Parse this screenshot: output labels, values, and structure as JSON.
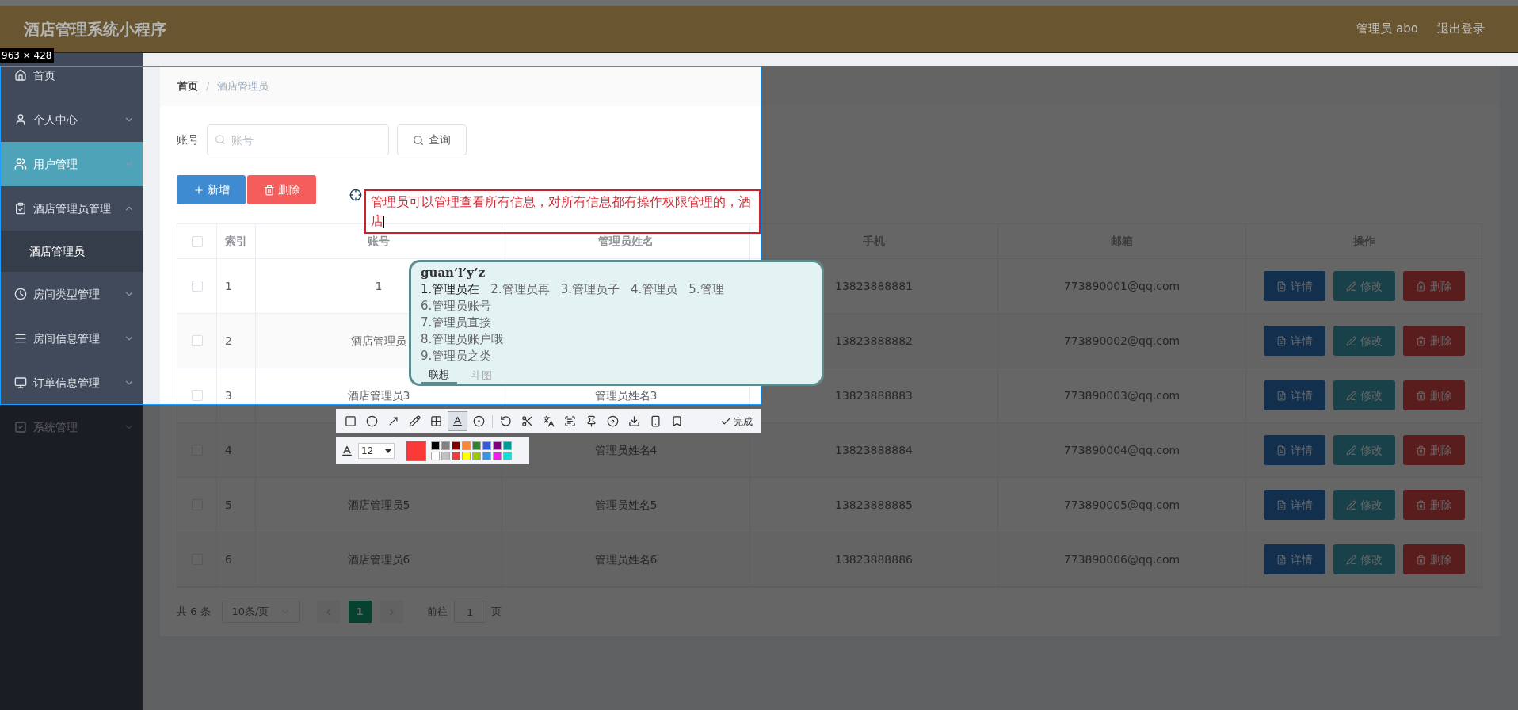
{
  "header": {
    "title": "酒店管理系统小程序",
    "user": "管理员 abo",
    "logout": "退出登录"
  },
  "sidebar": {
    "items": [
      {
        "label": "首页",
        "selected": false
      },
      {
        "label": "个人中心",
        "selected": false,
        "expanded": false
      },
      {
        "label": "用户管理",
        "selected": true,
        "expanded": false
      },
      {
        "label": "酒店管理员管理",
        "selected": false,
        "expanded": true,
        "children": [
          {
            "label": "酒店管理员",
            "selected": false
          }
        ]
      },
      {
        "label": "房间类型管理",
        "selected": false,
        "expanded": false
      },
      {
        "label": "房间信息管理",
        "selected": false,
        "expanded": false
      },
      {
        "label": "订单信息管理",
        "selected": false,
        "expanded": false
      },
      {
        "label": "系统管理",
        "selected": false,
        "expanded": false
      }
    ]
  },
  "breadcrumb": {
    "items": [
      "首页",
      "酒店管理员"
    ],
    "separator": "/"
  },
  "search": {
    "label": "账号",
    "placeholder": "账号",
    "button": "查询"
  },
  "toolbar": {
    "add": "新增",
    "delete": "删除"
  },
  "table": {
    "select_all": {
      "checked": false
    },
    "columns": [
      "索引",
      "账号",
      "管理员姓名",
      "手机",
      "邮箱",
      "操作"
    ],
    "rows": [
      {
        "checked": false,
        "index": "1",
        "account": "1",
        "phone": "13823888881",
        "email": "773890001@qq.com",
        "actions": [
          "详情",
          "修改",
          "删除"
        ]
      },
      {
        "checked": false,
        "index": "2",
        "account": "酒店管理员",
        "phone": "13823888882",
        "email": "773890002@qq.com",
        "actions": [
          "详情",
          "修改",
          "删除"
        ]
      },
      {
        "checked": false,
        "index": "3",
        "account": "酒店管理员3",
        "name": "管理员姓名3",
        "phone": "13823888883",
        "email": "773890003@qq.com",
        "actions": [
          "详情",
          "修改",
          "删除"
        ]
      },
      {
        "checked": false,
        "index": "4",
        "name": "管理员姓名4",
        "phone": "13823888884",
        "email": "773890004@qq.com",
        "actions": [
          "详情",
          "修改",
          "删除"
        ]
      },
      {
        "checked": false,
        "index": "5",
        "account": "酒店管理员5",
        "name": "管理员姓名5",
        "phone": "13823888885",
        "email": "773890005@qq.com",
        "actions": [
          "详情",
          "修改",
          "删除"
        ]
      },
      {
        "checked": false,
        "index": "6",
        "account": "酒店管理员6",
        "name": "管理员姓名6",
        "phone": "13823888886",
        "email": "773890006@qq.com",
        "actions": [
          "详情",
          "修改",
          "删除"
        ]
      }
    ]
  },
  "pagination": {
    "total": "共 6 条",
    "page_size": "10条/页",
    "pages": [
      {
        "label": "1",
        "selected": true
      }
    ],
    "goto": "前往",
    "goto_value": "1",
    "suffix": "页"
  },
  "capture": {
    "size_label": "963 × 428",
    "annotation": "管理员可以管理查看所有信息，对所有信息都有操作权限管理的，酒店",
    "tools": [
      {
        "selected": false
      },
      {
        "selected": false
      },
      {
        "selected": false
      },
      {
        "selected": false
      },
      {
        "selected": false
      },
      {
        "selected": true
      },
      {
        "selected": false
      },
      {
        "selected": false
      },
      {
        "selected": false
      },
      {
        "selected": false
      },
      {
        "selected": false
      },
      {
        "selected": false
      },
      {
        "selected": false
      },
      {
        "selected": false
      },
      {
        "selected": false
      },
      {
        "selected": false
      }
    ],
    "done": "完成",
    "font_size": "12",
    "palette": [
      {
        "color": "#000000",
        "selected": false
      },
      {
        "color": "#808080",
        "selected": false
      },
      {
        "color": "#800000",
        "selected": false
      },
      {
        "color": "#f7883a",
        "selected": false
      },
      {
        "color": "#308430",
        "selected": false
      },
      {
        "color": "#385ad3",
        "selected": false
      },
      {
        "color": "#800080",
        "selected": false
      },
      {
        "color": "#009999",
        "selected": false
      },
      {
        "color": "#ffffff",
        "selected": false
      },
      {
        "color": "#c0c0c0",
        "selected": false
      },
      {
        "color": "#fb3838",
        "selected": true
      },
      {
        "color": "#ffff00",
        "selected": false
      },
      {
        "color": "#99cc00",
        "selected": false
      },
      {
        "color": "#3894e4",
        "selected": false
      },
      {
        "color": "#f31bf3",
        "selected": false
      },
      {
        "color": "#16dcdc",
        "selected": false
      }
    ]
  },
  "ime": {
    "input": "guan’l’y’z",
    "candidates": [
      {
        "label": "1.管理员在",
        "selected": true
      },
      {
        "label": "2.管理员再",
        "selected": false
      },
      {
        "label": "3.管理员子",
        "selected": false
      },
      {
        "label": "4.管理员",
        "selected": false
      },
      {
        "label": "5.管理",
        "selected": false
      },
      {
        "label": "6.管理员账号",
        "selected": false
      },
      {
        "label": "7.管理员直接",
        "selected": false
      },
      {
        "label": "8.管理员账户哦",
        "selected": false
      },
      {
        "label": "9.管理员之类",
        "selected": false
      }
    ],
    "tabs": [
      {
        "label": "联想",
        "selected": true
      },
      {
        "label": "斗图",
        "selected": false
      }
    ]
  }
}
